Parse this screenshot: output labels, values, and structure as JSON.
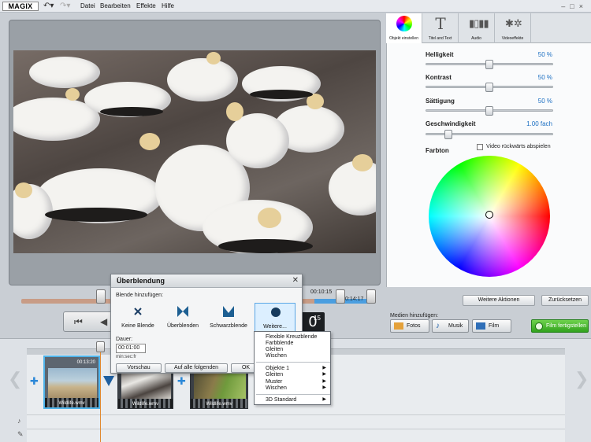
{
  "app": {
    "logo": "MAGIX"
  },
  "menu": {
    "items": [
      "Datei",
      "Bearbeiten",
      "Effekte",
      "Hilfe"
    ]
  },
  "icons": {
    "undo": "undo-icon",
    "redo": "redo-icon",
    "minimize": "minimize-icon",
    "maximize": "maximize-icon",
    "close": "close-icon"
  },
  "panel": {
    "tabs": [
      {
        "label": "Objekt einstellen",
        "icon": "color-wheel-icon"
      },
      {
        "label": "Titel and Text",
        "icon": "title-t-icon"
      },
      {
        "label": "Audio",
        "icon": "audio-waveform-icon"
      },
      {
        "label": "Videoeffekte",
        "icon": "video-effects-stars-icon"
      }
    ],
    "sliders": [
      {
        "label": "Helligkeit",
        "value": "50 %",
        "fraction": 0.5
      },
      {
        "label": "Kontrast",
        "value": "50 %",
        "fraction": 0.5
      },
      {
        "label": "Sättigung",
        "value": "50 %",
        "fraction": 0.5
      },
      {
        "label": "Geschwindigkeit",
        "value": "1.00  fach",
        "fraction": 0.18
      }
    ],
    "reverse_label": "Video rückwärts abspielen",
    "farbton_label": "Farbton",
    "actions": {
      "more": "Weitere Aktionen",
      "reset": "Zurücksetzen"
    }
  },
  "media": {
    "label": "Medien hinzufügen:",
    "photos": "Fotos",
    "music": "Musik",
    "film": "Film",
    "finish": "Film fertigstellen"
  },
  "player": {
    "time_a": "00:10:15",
    "time_b": "0:14:17",
    "timecode_big": "0",
    "timecode_small": "15"
  },
  "dialog": {
    "title": "Überblendung",
    "subtitle": "Blende hinzufügen:",
    "options": [
      {
        "label": "Keine Blende",
        "icon": "no-transition-icon"
      },
      {
        "label": "Überblenden",
        "icon": "crossfade-icon"
      },
      {
        "label": "Schwarzblende",
        "icon": "fade-to-black-icon"
      },
      {
        "label": "Weitere...",
        "icon": "more-transitions-icon"
      }
    ],
    "duration_label": "Dauer:",
    "duration_value": "00:01:00",
    "duration_unit": "min:sec:fr",
    "buttons": {
      "preview": "Vorschau",
      "apply_all": "Auf alle folgenden",
      "ok": "OK"
    }
  },
  "dropdown": {
    "group1": [
      "Flexible Kreuzblende",
      "Farbblende",
      "Gleiten",
      "Wischen"
    ],
    "group2": [
      "Objekte 1",
      "Gleiten",
      "Muster",
      "Wischen"
    ],
    "group3": [
      "3D Standard"
    ]
  },
  "timeline": {
    "clips": [
      {
        "name": "Wildlife.wmv",
        "time": "00:13:20"
      },
      {
        "name": "Wildlife.wmv",
        "time": ""
      },
      {
        "name": "Wildlife.wmv",
        "time": ""
      }
    ]
  }
}
